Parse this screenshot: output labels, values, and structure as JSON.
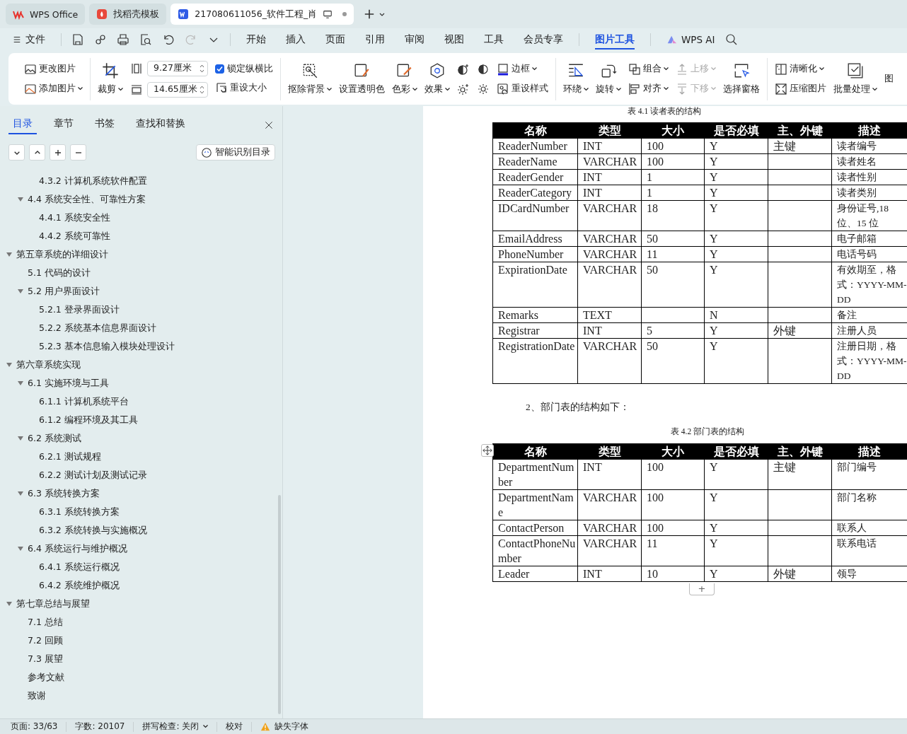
{
  "tabs": [
    {
      "label": "WPS Office",
      "kind": "home",
      "selected": false
    },
    {
      "label": "找稻壳模板",
      "kind": "template",
      "selected": false
    },
    {
      "label": "217080611056_软件工程_肖",
      "kind": "doc",
      "selected": true
    }
  ],
  "menu": {
    "file": "文件",
    "items": [
      {
        "label": "开始",
        "selected": false
      },
      {
        "label": "插入",
        "selected": false
      },
      {
        "label": "页面",
        "selected": false
      },
      {
        "label": "引用",
        "selected": false
      },
      {
        "label": "审阅",
        "selected": false
      },
      {
        "label": "视图",
        "selected": false
      },
      {
        "label": "工具",
        "selected": false
      },
      {
        "label": "会员专享",
        "selected": false
      },
      {
        "label": "图片工具",
        "selected": true
      }
    ],
    "ai": "WPS AI"
  },
  "ribbon": [
    {
      "columns": [
        [
          {
            "kind": "small",
            "label": "更改图片",
            "dropdown": false,
            "disabled": false
          },
          {
            "kind": "small",
            "label": "添加图片",
            "dropdown": true,
            "disabled": false
          }
        ]
      ]
    },
    {
      "columns": [
        [
          {
            "kind": "large",
            "label": "裁剪",
            "dropdown": true,
            "disabled": false
          }
        ],
        [
          {
            "kind": "field",
            "value": "9.27厘米"
          },
          {
            "kind": "field",
            "value": "14.65厘米"
          }
        ],
        [
          {
            "kind": "checkbox",
            "label": "锁定纵横比",
            "checked": true
          },
          {
            "kind": "small",
            "label": "重设大小",
            "dropdown": false,
            "disabled": false
          }
        ]
      ]
    },
    {
      "columns": [
        [
          {
            "kind": "large",
            "label": "抠除背景",
            "dropdown": true,
            "disabled": false
          }
        ],
        [
          {
            "kind": "large",
            "label": "设置透明色",
            "dropdown": false,
            "disabled": false
          }
        ],
        [
          {
            "kind": "large",
            "label": "色彩",
            "dropdown": true,
            "disabled": false
          }
        ],
        [
          {
            "kind": "large",
            "label": "效果",
            "dropdown": true,
            "disabled": false
          }
        ],
        [
          {
            "kind": "icon"
          },
          {
            "kind": "icon"
          }
        ],
        [
          {
            "kind": "icon"
          },
          {
            "kind": "icon"
          }
        ],
        [
          {
            "kind": "small",
            "label": "边框",
            "dropdown": true,
            "disabled": false
          },
          {
            "kind": "small",
            "label": "重设样式",
            "dropdown": false,
            "disabled": false
          }
        ]
      ]
    },
    {
      "columns": [
        [
          {
            "kind": "large",
            "label": "环绕",
            "dropdown": true,
            "disabled": false
          }
        ],
        [
          {
            "kind": "large",
            "label": "旋转",
            "dropdown": true,
            "disabled": false
          }
        ],
        [
          {
            "kind": "small",
            "label": "组合",
            "dropdown": true,
            "disabled": false
          },
          {
            "kind": "small",
            "label": "对齐",
            "dropdown": true,
            "disabled": false
          }
        ],
        [
          {
            "kind": "small",
            "label": "上移",
            "dropdown": true,
            "disabled": true
          },
          {
            "kind": "small",
            "label": "下移",
            "dropdown": true,
            "disabled": true
          }
        ],
        [
          {
            "kind": "large",
            "label": "选择窗格",
            "dropdown": false,
            "disabled": false
          }
        ]
      ]
    },
    {
      "columns": [
        [
          {
            "kind": "small",
            "label": "清晰化",
            "dropdown": true,
            "disabled": false
          },
          {
            "kind": "small",
            "label": "压缩图片",
            "dropdown": false,
            "disabled": false
          }
        ],
        [
          {
            "kind": "large",
            "label": "批量处理",
            "dropdown": true,
            "disabled": false
          }
        ],
        [
          {
            "kind": "text",
            "label": "图"
          }
        ]
      ]
    }
  ],
  "sidebar": {
    "tabs": [
      {
        "label": "目录",
        "selected": true
      },
      {
        "label": "章节",
        "selected": false
      },
      {
        "label": "书签",
        "selected": false
      },
      {
        "label": "查找和替换",
        "selected": false
      }
    ],
    "smart_button": "智能识别目录",
    "toc": [
      {
        "children": [
          {
            "children": [
              {
                "label": "4.3.2 计算机系统软件配置"
              }
            ]
          },
          {
            "label": "4.4 系统安全性、可靠性方案",
            "expanded": true,
            "children": [
              {
                "label": "4.4.1 系统安全性"
              },
              {
                "label": "4.4.2 系统可靠性"
              }
            ]
          }
        ]
      },
      {
        "label": "第五章系统的详细设计",
        "expanded": true,
        "children": [
          {
            "label": "5.1 代码的设计"
          },
          {
            "label": "5.2 用户界面设计",
            "expanded": true,
            "children": [
              {
                "label": "5.2.1 登录界面设计"
              },
              {
                "label": "5.2.2 系统基本信息界面设计"
              },
              {
                "label": "5.2.3 基本信息输入模块处理设计"
              }
            ]
          }
        ]
      },
      {
        "label": "第六章系统实现",
        "expanded": true,
        "children": [
          {
            "label": "6.1 实施环境与工具",
            "expanded": true,
            "children": [
              {
                "label": "6.1.1 计算机系统平台"
              },
              {
                "label": "6.1.2 编程环境及其工具"
              }
            ]
          },
          {
            "label": "6.2 系统测试",
            "expanded": true,
            "children": [
              {
                "label": "6.2.1 测试规程"
              },
              {
                "label": "6.2.2  测试计划及测试记录"
              }
            ]
          },
          {
            "label": "6.3 系统转换方案",
            "expanded": true,
            "children": [
              {
                "label": "6.3.1 系统转换方案"
              },
              {
                "label": "6.3.2 系统转换与实施概况"
              }
            ]
          },
          {
            "label": "6.4 系统运行与维护概况",
            "expanded": true,
            "children": [
              {
                "label": "6.4.1 系统运行概况"
              },
              {
                "label": "6.4.2 系统维护概况"
              }
            ]
          }
        ]
      },
      {
        "label": "第七章总结与展望",
        "expanded": true,
        "children": [
          {
            "label": "7.1 总结"
          },
          {
            "label": "7.2 回顾"
          },
          {
            "label": "7.3 展望"
          },
          {
            "label": "参考文献"
          },
          {
            "label": "致谢"
          }
        ]
      }
    ]
  },
  "document": {
    "caption_1": "表 4.1  读者表的结构",
    "header_1": [
      "名称",
      "类型",
      "大小",
      "是否必填",
      "主、外键",
      "描述"
    ],
    "table_1": [
      {
        "name": "ReaderNumber",
        "type": "INT",
        "size": "100",
        "required": "Y",
        "key": "主键",
        "description": "读者编号"
      },
      {
        "name": "ReaderName",
        "type": "VARCHAR",
        "size": "100",
        "required": "Y",
        "description": "读者姓名"
      },
      {
        "name": "ReaderGender",
        "type": "INT",
        "size": "1",
        "required": "Y",
        "description": "读者性别"
      },
      {
        "name": "ReaderCategory",
        "type": "INT",
        "size": "1",
        "required": "Y",
        "description": "读者类别"
      },
      {
        "name": "IDCardNumber",
        "type": "VARCHAR",
        "size": "18",
        "required": "Y",
        "description": "身份证号,18位、15 位"
      },
      {
        "name": "EmailAddress",
        "type": "VARCHAR",
        "size": "50",
        "required": "Y",
        "description": "电子邮箱"
      },
      {
        "name": "PhoneNumber",
        "type": "VARCHAR",
        "size": "11",
        "required": "Y",
        "description": "电话号码"
      },
      {
        "name": "ExpirationDate",
        "type": "VARCHAR",
        "size": "50",
        "required": "Y",
        "description": "有效期至，格式：YYYY-MM-DD"
      },
      {
        "name": "Remarks",
        "type": "TEXT",
        "required": "N",
        "description": "备注"
      },
      {
        "name": "Registrar",
        "type": "INT",
        "size": "5",
        "required": "Y",
        "key": "外键",
        "description": "注册人员"
      },
      {
        "name": "RegistrationDate",
        "type": "VARCHAR",
        "size": "50",
        "required": "Y",
        "description": "注册日期，格式：YYYY-MM-DD"
      }
    ],
    "paragraph": "2、部门表的结构如下：",
    "caption_2": "表 4.2 部门表的结构",
    "header_2": [
      "名称",
      "类型",
      "大小",
      "是否必填",
      "主、外键",
      "描述"
    ],
    "table_2": [
      {
        "name": "DepartmentNumber",
        "type": "INT",
        "size": "100",
        "required": "Y",
        "key": "主键",
        "description": "部门编号"
      },
      {
        "name": "DepartmentName",
        "type": "VARCHAR",
        "size": "100",
        "required": "Y",
        "description": "部门名称"
      },
      {
        "name": "ContactPerson",
        "type": "VARCHAR",
        "size": "100",
        "required": "Y",
        "description": "联系人"
      },
      {
        "name": "ContactPhoneNumber",
        "type": "VARCHAR",
        "size": "11",
        "required": "Y",
        "description": "联系电话"
      },
      {
        "name": "Leader",
        "type": "INT",
        "size": "10",
        "required": "Y",
        "key": "外键",
        "description": "领导"
      }
    ],
    "add_row": "+"
  },
  "status_bar": {
    "page": "页面: 33/63",
    "words": "字数: 20107",
    "spell": "拼写检查: 关闭",
    "proof": "校对",
    "missing_fonts": "缺失字体"
  }
}
